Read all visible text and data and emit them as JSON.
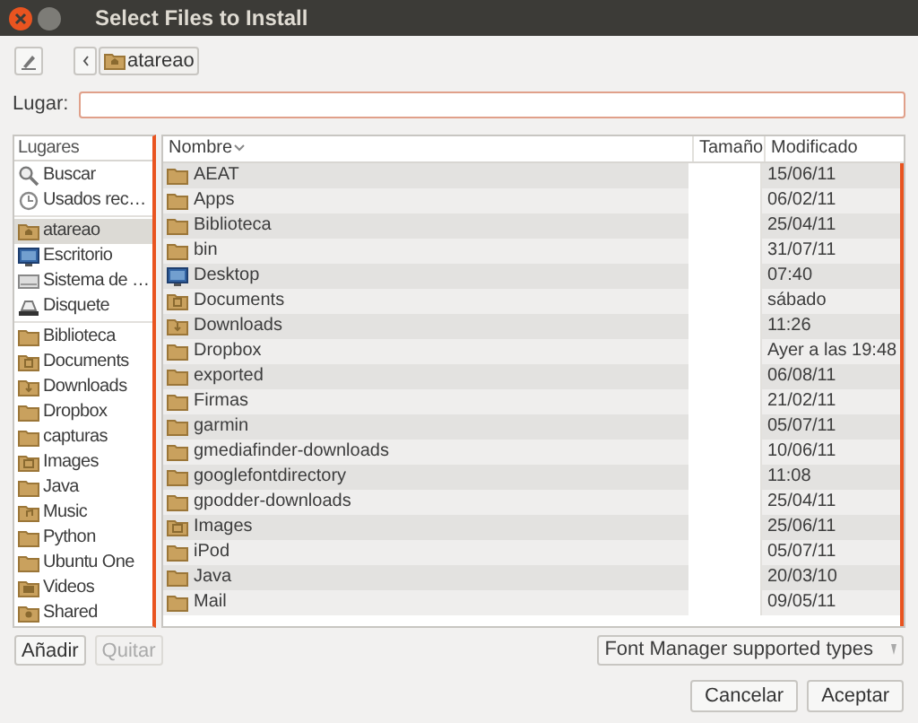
{
  "window": {
    "title": "Select Files to Install"
  },
  "path_bar": {
    "current": "atareao"
  },
  "location": {
    "label": "Lugar:"
  },
  "sidebar": {
    "header": "Lugares",
    "groups": [
      [
        {
          "label": "Buscar",
          "kind": "search",
          "selected": false
        },
        {
          "label": "Usados rec…",
          "kind": "recent",
          "selected": false
        }
      ],
      [
        {
          "label": "atareao",
          "kind": "home",
          "selected": true
        },
        {
          "label": "Escritorio",
          "kind": "desktop",
          "selected": false
        },
        {
          "label": "Sistema de …",
          "kind": "drive",
          "selected": false
        },
        {
          "label": "Disquete",
          "kind": "floppy",
          "selected": false
        }
      ],
      [
        {
          "label": "Biblioteca",
          "kind": "folder",
          "selected": false
        },
        {
          "label": "Documents",
          "kind": "documents",
          "selected": false
        },
        {
          "label": "Downloads",
          "kind": "downloads",
          "selected": false
        },
        {
          "label": "Dropbox",
          "kind": "folder",
          "selected": false
        },
        {
          "label": "capturas",
          "kind": "folder",
          "selected": false
        },
        {
          "label": "Images",
          "kind": "images",
          "selected": false
        },
        {
          "label": "Java",
          "kind": "folder",
          "selected": false
        },
        {
          "label": "Music",
          "kind": "music",
          "selected": false
        },
        {
          "label": "Python",
          "kind": "folder",
          "selected": false
        },
        {
          "label": "Ubuntu One",
          "kind": "folder",
          "selected": false
        },
        {
          "label": "Videos",
          "kind": "videos",
          "selected": false
        },
        {
          "label": "Shared",
          "kind": "shared",
          "selected": false
        }
      ]
    ]
  },
  "table": {
    "columns": [
      "Nombre",
      "Tamaño",
      "Modificado"
    ],
    "rows": [
      {
        "name": "AEAT",
        "kind": "folder",
        "modified": "15/06/11"
      },
      {
        "name": "Apps",
        "kind": "folder",
        "modified": "06/02/11"
      },
      {
        "name": "Biblioteca",
        "kind": "folder",
        "modified": "25/04/11"
      },
      {
        "name": "bin",
        "kind": "folder",
        "modified": "31/07/11"
      },
      {
        "name": "Desktop",
        "kind": "desktop",
        "modified": "07:40"
      },
      {
        "name": "Documents",
        "kind": "documents",
        "modified": "sábado"
      },
      {
        "name": "Downloads",
        "kind": "downloads",
        "modified": "11:26"
      },
      {
        "name": "Dropbox",
        "kind": "folder",
        "modified": "Ayer a las 19:48"
      },
      {
        "name": "exported",
        "kind": "folder",
        "modified": "06/08/11"
      },
      {
        "name": "Firmas",
        "kind": "folder",
        "modified": "21/02/11"
      },
      {
        "name": "garmin",
        "kind": "folder",
        "modified": "05/07/11"
      },
      {
        "name": "gmediafinder-downloads",
        "kind": "folder",
        "modified": "10/06/11"
      },
      {
        "name": "googlefontdirectory",
        "kind": "folder",
        "modified": "11:08"
      },
      {
        "name": "gpodder-downloads",
        "kind": "folder",
        "modified": "25/04/11"
      },
      {
        "name": "Images",
        "kind": "images",
        "modified": "25/06/11"
      },
      {
        "name": "iPod",
        "kind": "folder",
        "modified": "05/07/11"
      },
      {
        "name": "Java",
        "kind": "folder",
        "modified": "20/03/10"
      },
      {
        "name": "Mail",
        "kind": "folder",
        "modified": "09/05/11"
      }
    ]
  },
  "sidebar_buttons": [
    {
      "label": "Añadir",
      "disabled": false
    },
    {
      "label": "Quitar",
      "disabled": true
    }
  ],
  "filter": {
    "value": "Font Manager supported types"
  },
  "buttons": [
    "Cancelar",
    "Aceptar"
  ]
}
